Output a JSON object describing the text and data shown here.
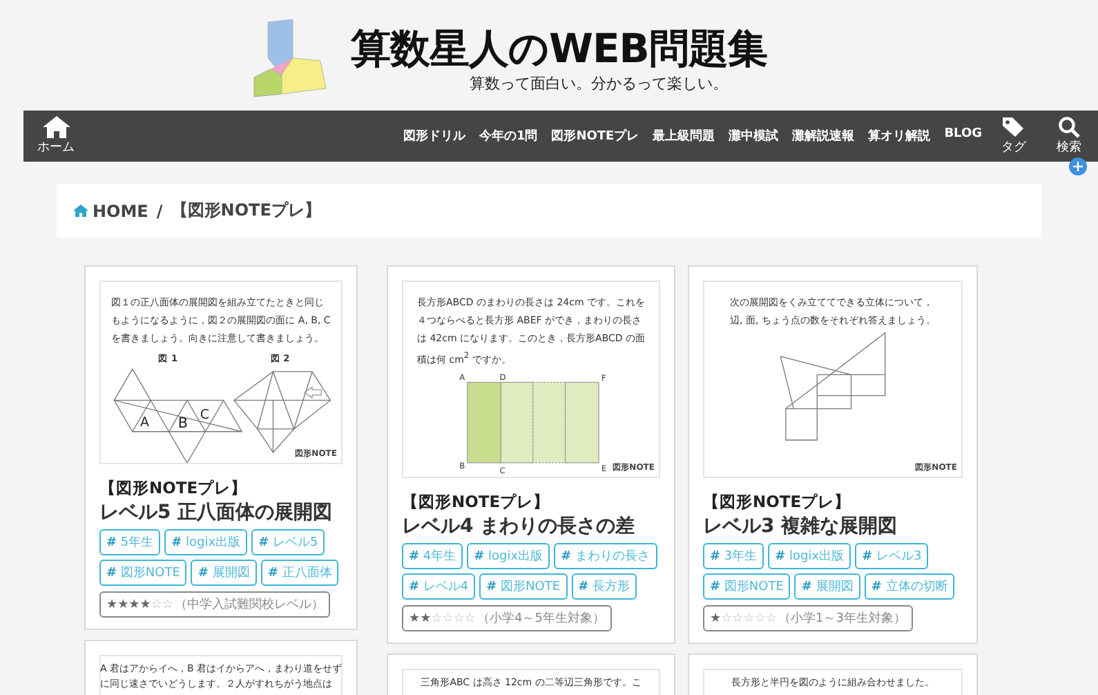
{
  "site": {
    "title": "算数星人のWEB問題集",
    "tagline": "算数って面白い。分かるって楽しい。"
  },
  "nav": {
    "home": "ホーム",
    "items": [
      "図形ドリル",
      "今年の1問",
      "図形NOTEプレ",
      "最上級問題",
      "灘中模試",
      "灘解説速報",
      "算オリ解説",
      "BLOG"
    ],
    "tag": "タグ",
    "search": "検索"
  },
  "breadcrumb": {
    "home": "HOME",
    "separator": "/",
    "current": "【図形NOTEプレ】"
  },
  "columns": [
    [
      {
        "figure": {
          "kind": "octahedron",
          "lines": [
            "図１の正八面体の展開図を組み立てたときと同じ",
            "もようになるように，図２の展開図の面に A, B, C",
            "を書きましょう。向きに注意して書きましょう。"
          ],
          "labels": [
            "図 1",
            "図 2",
            "A",
            "B",
            "C"
          ],
          "credit": "図形NOTE"
        },
        "category": "【図形NOTEプレ】",
        "title": "レベル5 正八面体の展開図",
        "tags": [
          "**#** 5年生",
          "**#** logix出版",
          "**#** レベル5",
          "**#** 図形NOTE",
          "**#** 展開図",
          "**#** 正八面体"
        ],
        "stars": 4,
        "level": "（中学入試難関校レベル）"
      },
      {
        "figure": {
          "kind": "text",
          "lines": [
            "A 君はアからイへ，B 君はイからアへ，まわり道をせず",
            "に同じ速さでいどうします。２人がすれちがう地点は"
          ]
        }
      }
    ],
    [
      {
        "figure": {
          "kind": "rectangles",
          "lines": [
            "長方形ABCD のまわりの長さは 24cm です。これを",
            "４つならべると長方形 ABEF ができ，まわりの長さ",
            "は 42cm になります。このとき，長方形ABCD の面",
            "積は何 cm$^{2}$ ですか。"
          ],
          "labels": [
            "A",
            "D",
            "F",
            "B",
            "C",
            "E"
          ],
          "credit": "図形NOTE"
        },
        "category": "【図形NOTEプレ】",
        "title": "レベル4 まわりの長さの差",
        "tags": [
          "**#** 4年生",
          "**#** logix出版",
          "**#** まわりの長さ",
          "**#** レベル4",
          "**#** 図形NOTE",
          "**#** 長方形"
        ],
        "stars": 2,
        "level": "（小学4～5年生対象）"
      },
      {
        "figure": {
          "kind": "text",
          "lines": [
            "三角形ABC は高さ 12cm の二等辺三角形です。こ"
          ]
        }
      }
    ],
    [
      {
        "figure": {
          "kind": "cube-net",
          "lines": [
            "次の展開図をくみ立ててできる立体について，",
            "辺, 面, ちょう点の数をそれぞれ答えましょう。"
          ],
          "credit": "図形NOTE"
        },
        "category": "【図形NOTEプレ】",
        "title": "レベル3 複雑な展開図",
        "tags": [
          "**#** 3年生",
          "**#** logix出版",
          "**#** レベル3",
          "**#** 図形NOTE",
          "**#** 展開図",
          "**#** 立体の切断"
        ],
        "stars": 1,
        "level": "（小学1～3年生対象）"
      },
      {
        "figure": {
          "kind": "text",
          "lines": [
            "長方形と半円を図のように組み合わせました。"
          ]
        }
      }
    ]
  ]
}
